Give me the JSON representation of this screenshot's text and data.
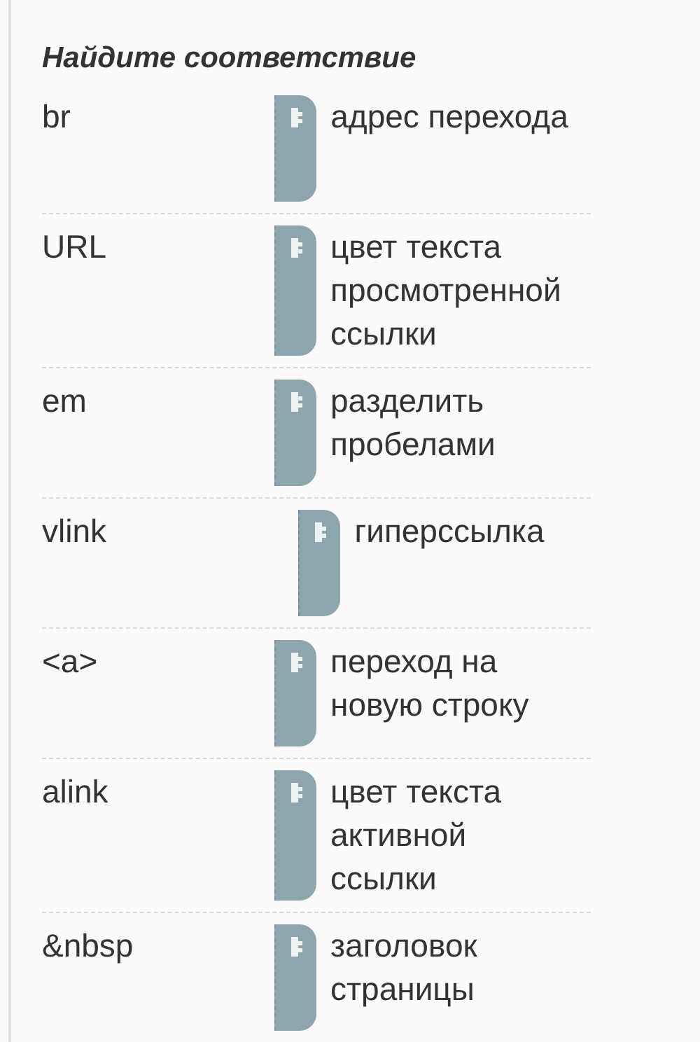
{
  "title": "Найдите соответствие",
  "pairs": [
    {
      "term": "br",
      "answer": "адрес перехода"
    },
    {
      "term": "URL",
      "answer": "цвет текста просмотренной ссылки"
    },
    {
      "term": "em",
      "answer": "разделить пробелами"
    },
    {
      "term": "vlink",
      "answer": "гиперссылка"
    },
    {
      "term": "<a>",
      "answer": "переход на новую строку"
    },
    {
      "term": "alink",
      "answer": "цвет текста активной ссылки"
    },
    {
      "term": "&nbsp",
      "answer": "заголовок страницы"
    }
  ]
}
